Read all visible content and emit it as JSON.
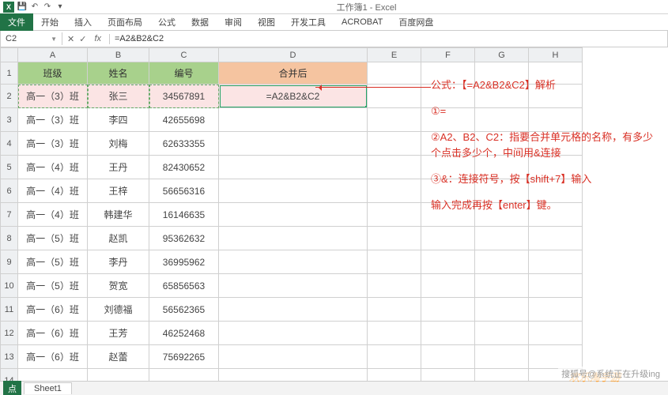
{
  "window": {
    "title": "工作簿1 - Excel"
  },
  "ribbon": {
    "file": "文件",
    "tabs": [
      "开始",
      "插入",
      "页面布局",
      "公式",
      "数据",
      "审阅",
      "视图",
      "开发工具",
      "ACROBAT",
      "百度网盘"
    ]
  },
  "nameBox": "C2",
  "formulaBar": "=A2&B2&C2",
  "columns": [
    "A",
    "B",
    "C",
    "D",
    "E",
    "F",
    "G",
    "H"
  ],
  "headers": {
    "A": "班级",
    "B": "姓名",
    "C": "编号",
    "D": "合并后"
  },
  "activeFormula": "=A2&B2&C2",
  "rows": [
    {
      "n": 2,
      "a": "高一（3）班",
      "b": "张三",
      "c": "34567891"
    },
    {
      "n": 3,
      "a": "高一（3）班",
      "b": "李四",
      "c": "42655698"
    },
    {
      "n": 4,
      "a": "高一（3）班",
      "b": "刘梅",
      "c": "62633355"
    },
    {
      "n": 5,
      "a": "高一（4）班",
      "b": "王丹",
      "c": "82430652"
    },
    {
      "n": 6,
      "a": "高一（4）班",
      "b": "王梓",
      "c": "56656316"
    },
    {
      "n": 7,
      "a": "高一（4）班",
      "b": "韩建华",
      "c": "16146635"
    },
    {
      "n": 8,
      "a": "高一（5）班",
      "b": "赵凯",
      "c": "95362632"
    },
    {
      "n": 9,
      "a": "高一（5）班",
      "b": "李丹",
      "c": "36995962"
    },
    {
      "n": 10,
      "a": "高一（5）班",
      "b": "贺宽",
      "c": "65856563"
    },
    {
      "n": 11,
      "a": "高一（6）班",
      "b": "刘德福",
      "c": "56562365"
    },
    {
      "n": 12,
      "a": "高一（6）班",
      "b": "王芳",
      "c": "46252468"
    },
    {
      "n": 13,
      "a": "高一（6）班",
      "b": "赵蕾",
      "c": "75692265"
    }
  ],
  "extraRows": [
    14
  ],
  "annotation": {
    "l1": "公式：【=A2&B2&C2】解析",
    "l2": "①=",
    "l3": "②A2、B2、C2：指要合并单元格的名称，有多少个点击多少个，中间用&连接",
    "l4": "③&：连接符号，按【shift+7】输入",
    "l5": "输入完成再按【enter】键。"
  },
  "sheetTab": "Sheet1",
  "status": "点",
  "watermark": "搜狐号@系统正在升级ing",
  "logoWm": "欢乐淘手游"
}
